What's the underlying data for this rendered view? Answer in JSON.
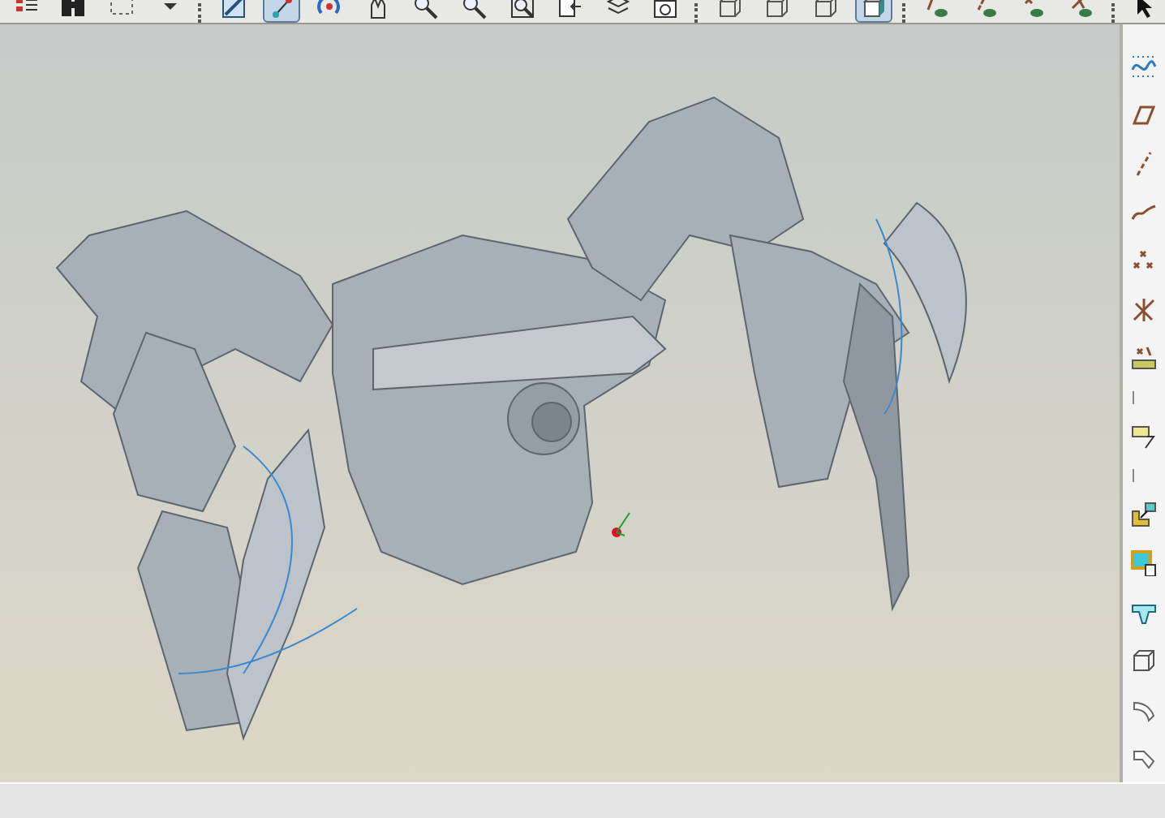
{
  "top_toolbar": [
    {
      "kind": "list",
      "selected": false
    },
    {
      "kind": "binoculars",
      "selected": false
    },
    {
      "kind": "dotted-box",
      "selected": false
    },
    {
      "kind": "caret",
      "selected": false
    },
    {
      "kind": "separator"
    },
    {
      "kind": "sketch",
      "selected": false
    },
    {
      "kind": "datum",
      "selected": true
    },
    {
      "kind": "spin",
      "selected": false
    },
    {
      "kind": "hand",
      "selected": false
    },
    {
      "kind": "magnifier",
      "selected": false
    },
    {
      "kind": "magnifier",
      "selected": false
    },
    {
      "kind": "fit",
      "selected": false
    },
    {
      "kind": "view",
      "selected": false
    },
    {
      "kind": "layers",
      "selected": false
    },
    {
      "kind": "camera",
      "selected": false
    },
    {
      "kind": "separator"
    },
    {
      "kind": "wire-cube",
      "selected": false
    },
    {
      "kind": "wire-cube",
      "selected": false
    },
    {
      "kind": "wire-cube",
      "selected": false
    },
    {
      "kind": "shaded-cube",
      "selected": true
    },
    {
      "kind": "separator"
    },
    {
      "kind": "plane-eye",
      "selected": false
    },
    {
      "kind": "axis-eye",
      "selected": false
    },
    {
      "kind": "point-eye",
      "selected": false
    },
    {
      "kind": "csys-eye",
      "selected": false
    },
    {
      "kind": "separator"
    },
    {
      "kind": "pointer",
      "selected": false
    }
  ],
  "right_toolbar": [
    {
      "kind": "dotted-curve"
    },
    {
      "kind": "plane"
    },
    {
      "kind": "axis"
    },
    {
      "kind": "curve"
    },
    {
      "kind": "points"
    },
    {
      "kind": "csys"
    },
    {
      "kind": "analysis"
    },
    {
      "kind": "separator"
    },
    {
      "kind": "note"
    },
    {
      "kind": "separator"
    },
    {
      "kind": "copy"
    },
    {
      "kind": "shade-doc"
    },
    {
      "kind": "channel"
    },
    {
      "kind": "wire-cube"
    },
    {
      "kind": "round"
    },
    {
      "kind": "chamfer"
    }
  ]
}
